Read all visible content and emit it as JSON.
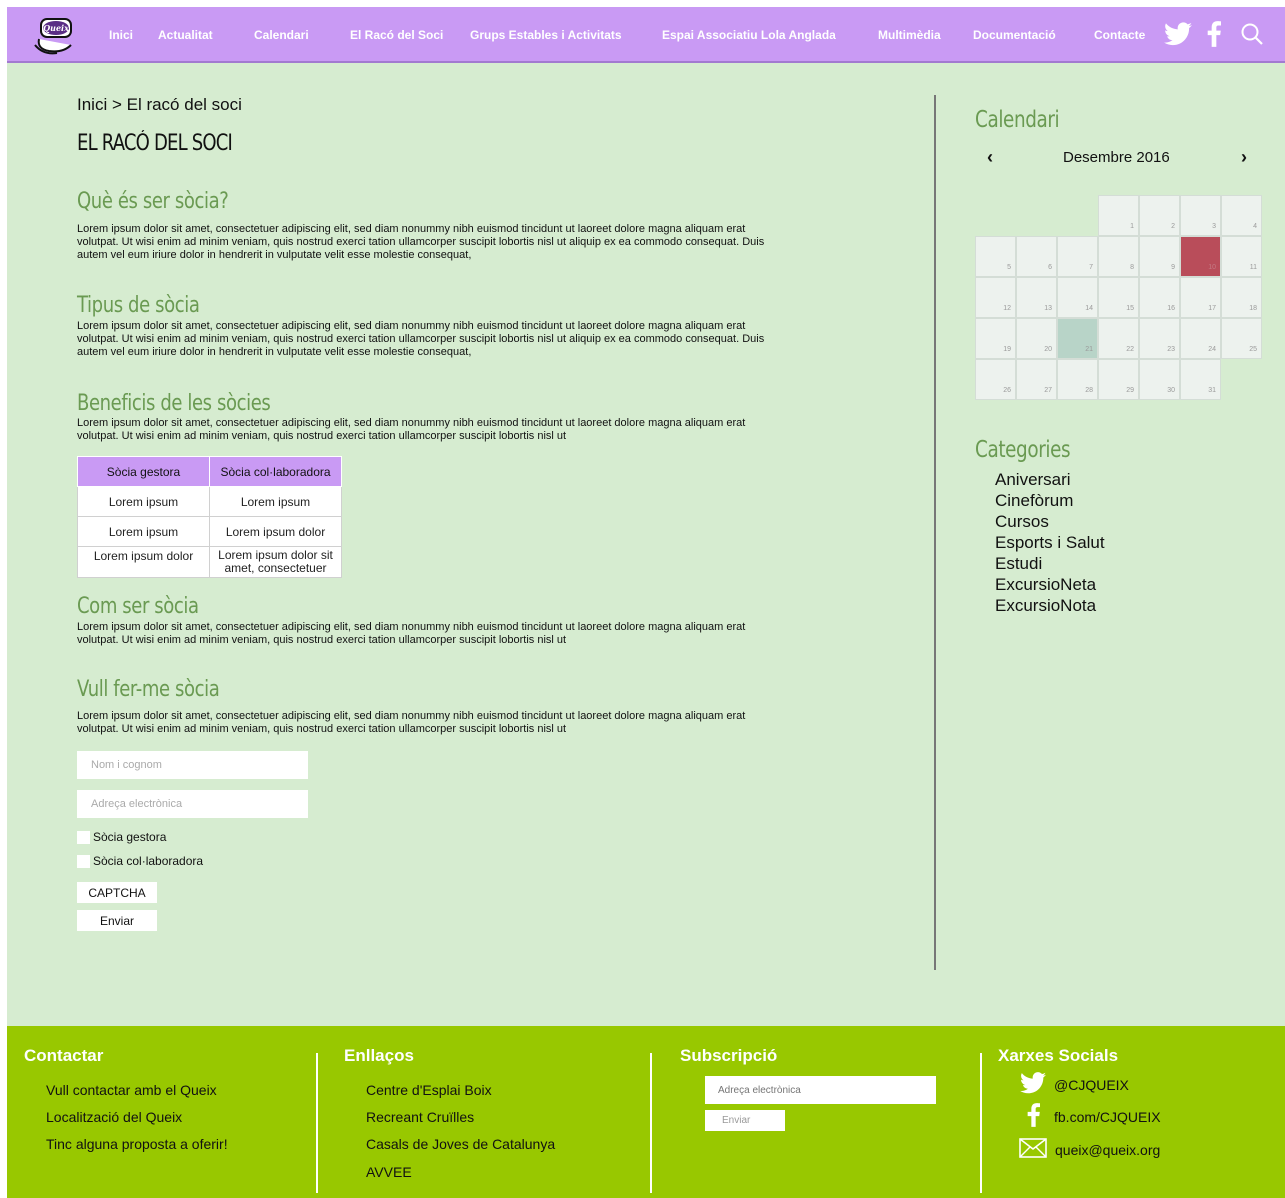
{
  "nav": {
    "logo_text": "Queix",
    "items": [
      "Inici",
      "Actualitat",
      "Calendari",
      "El Racó del Soci",
      "Grups Estables i Activitats",
      "Espai Associatiu Lola Anglada",
      "Multimèdia",
      "Documentació",
      "Contacte"
    ],
    "icons": [
      "twitter-icon",
      "facebook-icon",
      "search-icon"
    ]
  },
  "colors": {
    "nav_bg": "#c99af4",
    "page_bg": "#d6ecd0",
    "heading_green": "#6a9a52",
    "footer_bg": "#98c800",
    "today": "#b94d5a",
    "selected_day": "#b8d4c8"
  },
  "breadcrumb": "Inici > El racó del soci",
  "page_title": "EL RACÓ DEL SOCI",
  "sections": [
    {
      "title": "Què és ser sòcia?",
      "text": "Lorem ipsum dolor sit amet, consectetuer adipiscing elit, sed diam nonummy nibh euismod tincidunt ut laoreet dolore magna aliquam erat volutpat. Ut wisi enim ad minim veniam, quis nostrud exerci tation ullamcorper suscipit lobortis nisl ut aliquip ex ea commodo consequat. Duis autem vel eum iriure dolor in hendrerit in vulputate velit esse molestie consequat,"
    },
    {
      "title": "Tipus de sòcia",
      "text": "Lorem ipsum dolor sit amet, consectetuer adipiscing elit, sed diam nonummy nibh euismod tincidunt ut laoreet dolore magna aliquam erat volutpat. Ut wisi enim ad minim veniam, quis nostrud exerci tation ullamcorper suscipit lobortis nisl ut aliquip ex ea commodo consequat. Duis autem vel eum iriure dolor in hendrerit in vulputate velit esse molestie consequat,"
    },
    {
      "title": "Beneficis de les sòcies",
      "text": "Lorem ipsum dolor sit amet, consectetuer adipiscing elit, sed diam nonummy nibh euismod tincidunt ut laoreet dolore magna aliquam erat volutpat. Ut wisi enim ad minim veniam, quis nostrud exerci tation ullamcorper suscipit lobortis nisl ut"
    },
    {
      "title": "Com ser sòcia",
      "text": "Lorem ipsum dolor sit amet, consectetuer adipiscing elit, sed diam nonummy nibh euismod tincidunt ut laoreet dolore magna aliquam erat volutpat. Ut wisi enim ad minim veniam, quis nostrud exerci tation ullamcorper suscipit lobortis nisl ut"
    },
    {
      "title": "Vull fer-me sòcia",
      "text": "Lorem ipsum dolor sit amet, consectetuer adipiscing elit, sed diam nonummy nibh euismod tincidunt ut laoreet dolore magna aliquam erat volutpat. Ut wisi enim ad minim veniam, quis nostrud exerci tation ullamcorper suscipit lobortis nisl ut"
    }
  ],
  "benefits_table": {
    "headers": [
      "Sòcia gestora",
      "Sòcia col·laboradora"
    ],
    "rows": [
      [
        "Lorem ipsum",
        "Lorem ipsum"
      ],
      [
        "Lorem ipsum",
        "Lorem ipsum dolor"
      ],
      [
        "Lorem ipsum dolor",
        "Lorem ipsum dolor sit amet, consectetuer"
      ]
    ]
  },
  "form": {
    "name_placeholder": "Nom i cognom",
    "email_placeholder": "Adreça electrònica",
    "checkbox_gestora": "Sòcia gestora",
    "checkbox_colaboradora": "Sòcia col·laboradora",
    "captcha_label": "CAPTCHA",
    "submit_label": "Enviar"
  },
  "calendar": {
    "title": "Calendari",
    "month": "Desembre 2016",
    "prev": "‹",
    "next": "›",
    "first_weekday_index": 3,
    "days_in_month": 31,
    "today": 10,
    "selected": 21
  },
  "categories": {
    "title": "Categories",
    "items": [
      "Aniversari",
      "Cinefòrum",
      "Cursos",
      "Esports i Salut",
      "Estudi",
      "ExcursioNeta",
      "ExcursioNota"
    ]
  },
  "footer": {
    "contact": {
      "title": "Contactar",
      "links": [
        "Vull contactar amb el Queix",
        "Localització del Queix",
        "Tinc alguna proposta a oferir!"
      ]
    },
    "links": {
      "title": "Enllaços",
      "links": [
        "Centre d'Esplai Boix",
        "Recreant Cruïlles",
        "Casals de Joves de Catalunya",
        "AVVEE"
      ]
    },
    "subscribe": {
      "title": "Subscripció",
      "placeholder": "Adreça electrònica",
      "button": "Enviar"
    },
    "social": {
      "title": "Xarxes Socials",
      "twitter": "@CJQUEIX",
      "facebook": "fb.com/CJQUEIX",
      "email": "queix@queix.org"
    }
  }
}
